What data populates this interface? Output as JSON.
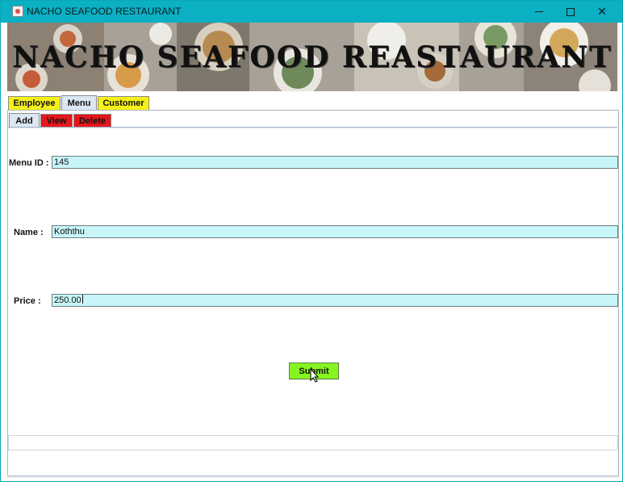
{
  "window": {
    "title": "NACHO SEAFOOD RESTAURANT",
    "accent_color": "#0bb0c3"
  },
  "banner": {
    "title": "NACHO SEAFOOD REASTAURANT"
  },
  "main_tabs": [
    {
      "label": "Employee",
      "color": "#f5f01a",
      "selected": false
    },
    {
      "label": "Menu",
      "color": "#dbe7f3",
      "selected": true
    },
    {
      "label": "Customer",
      "color": "#f5f01a",
      "selected": false
    }
  ],
  "sub_tabs": [
    {
      "label": "Add",
      "color": "#dbe7f3",
      "selected": true
    },
    {
      "label": "View",
      "color": "#e4161b",
      "selected": false
    },
    {
      "label": "Delete",
      "color": "#e4161b",
      "selected": false
    }
  ],
  "form": {
    "menu_id_label": "Menu ID :",
    "menu_id_value": "145",
    "name_label": "Name :",
    "name_value": "Koththu",
    "price_label": "Price :",
    "price_value": "250.00",
    "field_color": "#c8f6f8"
  },
  "actions": {
    "submit_label": "Submit",
    "submit_color": "#86f51f"
  }
}
